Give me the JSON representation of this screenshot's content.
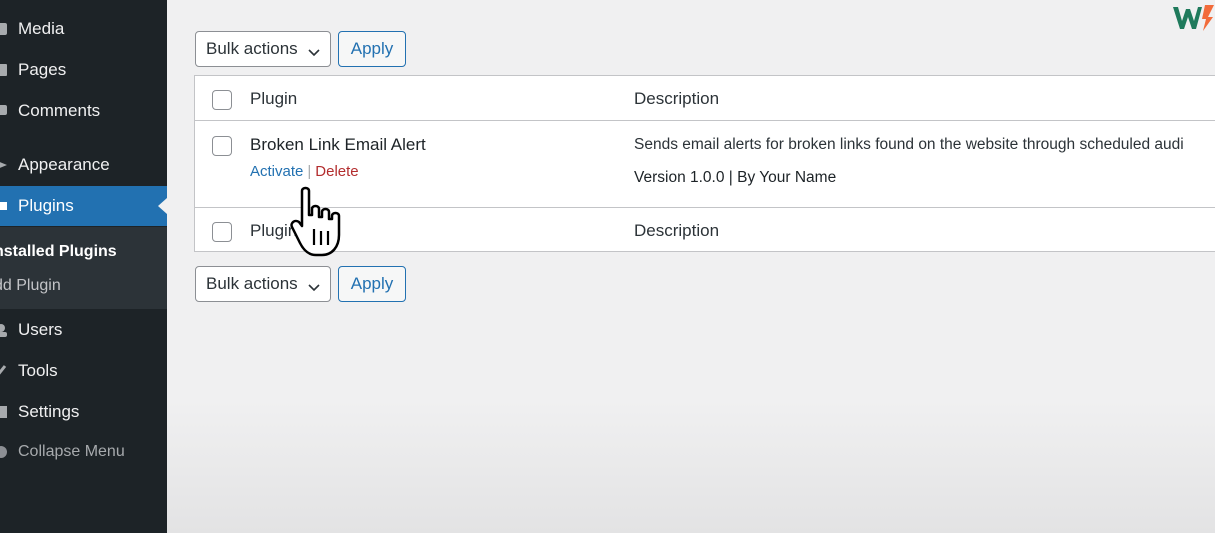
{
  "sidebar": {
    "items": [
      {
        "label": "Media",
        "icon": "media-icon"
      },
      {
        "label": "Pages",
        "icon": "pages-icon"
      },
      {
        "label": "Comments",
        "icon": "comments-icon"
      },
      {
        "label": "Appearance",
        "icon": "appearance-icon"
      },
      {
        "label": "Plugins",
        "icon": "plugins-icon"
      },
      {
        "label": "Users",
        "icon": "users-icon"
      },
      {
        "label": "Tools",
        "icon": "tools-icon"
      },
      {
        "label": "Settings",
        "icon": "settings-icon"
      }
    ],
    "submenu": {
      "installed": "nstalled Plugins",
      "add": "dd Plugin"
    },
    "collapse_label": "Collapse Menu"
  },
  "toolbar_top": {
    "bulk_label": "Bulk actions",
    "apply_label": "Apply"
  },
  "toolbar_bottom": {
    "bulk_label": "Bulk actions",
    "apply_label": "Apply"
  },
  "table": {
    "header": {
      "plugin": "Plugin",
      "description": "Description"
    },
    "footer": {
      "plugin": "Plugin",
      "description": "Description"
    },
    "rows": [
      {
        "name": "Broken Link Email Alert",
        "activate": "Activate",
        "separator": "|",
        "delete": "Delete",
        "description": "Sends email alerts for broken links found on the website through scheduled audi",
        "meta": "Version 1.0.0 | By Your Name"
      }
    ]
  },
  "colors": {
    "sidebar_bg": "#1d2327",
    "accent": "#2271b1",
    "delete": "#b32d2e"
  }
}
